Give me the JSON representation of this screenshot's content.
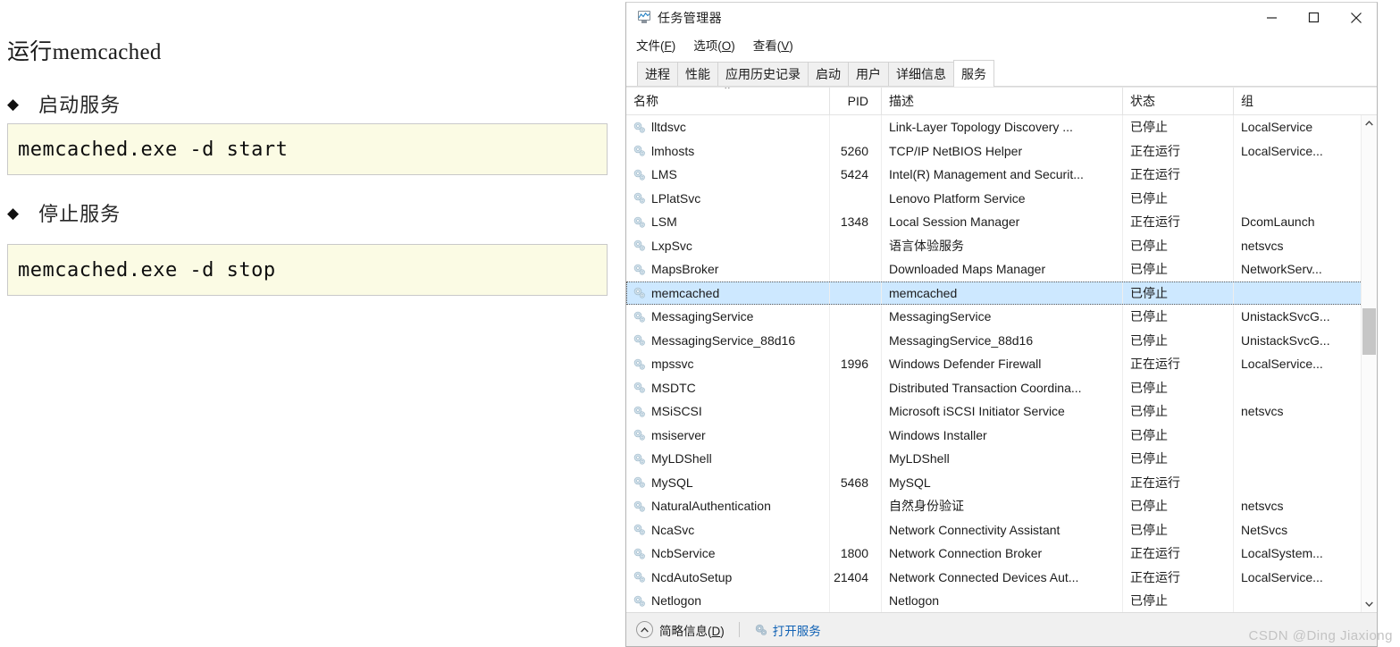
{
  "doc": {
    "title": "运行memcached",
    "sections": [
      {
        "bullet": "◆",
        "heading": "启动服务",
        "code": "memcached.exe -d start"
      },
      {
        "bullet": "◆",
        "heading": "停止服务",
        "code": "memcached.exe -d stop"
      }
    ]
  },
  "taskmanager": {
    "title": "任务管理器",
    "window_buttons": {
      "minimize": "minimize-icon",
      "maximize": "maximize-icon",
      "close": "close-icon"
    },
    "menu": [
      {
        "label": "文件",
        "accel": "F"
      },
      {
        "label": "选项",
        "accel": "O"
      },
      {
        "label": "查看",
        "accel": "V"
      }
    ],
    "tabs": [
      {
        "label": "进程",
        "active": false
      },
      {
        "label": "性能",
        "active": false
      },
      {
        "label": "应用历史记录",
        "active": false
      },
      {
        "label": "启动",
        "active": false
      },
      {
        "label": "用户",
        "active": false
      },
      {
        "label": "详细信息",
        "active": false
      },
      {
        "label": "服务",
        "active": true
      }
    ],
    "table": {
      "sort_indicator": "⌃",
      "columns": [
        "名称",
        "PID",
        "描述",
        "状态",
        "组"
      ],
      "rows": [
        {
          "name": "lltdsvc",
          "pid": "",
          "desc": "Link-Layer Topology Discovery ...",
          "status": "已停止",
          "group": "LocalService",
          "selected": false
        },
        {
          "name": "lmhosts",
          "pid": "5260",
          "desc": "TCP/IP NetBIOS Helper",
          "status": "正在运行",
          "group": "LocalService...",
          "selected": false
        },
        {
          "name": "LMS",
          "pid": "5424",
          "desc": "Intel(R) Management and Securit...",
          "status": "正在运行",
          "group": "",
          "selected": false
        },
        {
          "name": "LPlatSvc",
          "pid": "",
          "desc": "Lenovo Platform Service",
          "status": "已停止",
          "group": "",
          "selected": false
        },
        {
          "name": "LSM",
          "pid": "1348",
          "desc": "Local Session Manager",
          "status": "正在运行",
          "group": "DcomLaunch",
          "selected": false
        },
        {
          "name": "LxpSvc",
          "pid": "",
          "desc": "语言体验服务",
          "status": "已停止",
          "group": "netsvcs",
          "selected": false
        },
        {
          "name": "MapsBroker",
          "pid": "",
          "desc": "Downloaded Maps Manager",
          "status": "已停止",
          "group": "NetworkServ...",
          "selected": false
        },
        {
          "name": "memcached",
          "pid": "",
          "desc": "memcached",
          "status": "已停止",
          "group": "",
          "selected": true
        },
        {
          "name": "MessagingService",
          "pid": "",
          "desc": "MessagingService",
          "status": "已停止",
          "group": "UnistackSvcG...",
          "selected": false
        },
        {
          "name": "MessagingService_88d16",
          "pid": "",
          "desc": "MessagingService_88d16",
          "status": "已停止",
          "group": "UnistackSvcG...",
          "selected": false
        },
        {
          "name": "mpssvc",
          "pid": "1996",
          "desc": "Windows Defender Firewall",
          "status": "正在运行",
          "group": "LocalService...",
          "selected": false
        },
        {
          "name": "MSDTC",
          "pid": "",
          "desc": "Distributed Transaction Coordina...",
          "status": "已停止",
          "group": "",
          "selected": false
        },
        {
          "name": "MSiSCSI",
          "pid": "",
          "desc": "Microsoft iSCSI Initiator Service",
          "status": "已停止",
          "group": "netsvcs",
          "selected": false
        },
        {
          "name": "msiserver",
          "pid": "",
          "desc": "Windows Installer",
          "status": "已停止",
          "group": "",
          "selected": false
        },
        {
          "name": "MyLDShell",
          "pid": "",
          "desc": "MyLDShell",
          "status": "已停止",
          "group": "",
          "selected": false
        },
        {
          "name": "MySQL",
          "pid": "5468",
          "desc": "MySQL",
          "status": "正在运行",
          "group": "",
          "selected": false
        },
        {
          "name": "NaturalAuthentication",
          "pid": "",
          "desc": "自然身份验证",
          "status": "已停止",
          "group": "netsvcs",
          "selected": false
        },
        {
          "name": "NcaSvc",
          "pid": "",
          "desc": "Network Connectivity Assistant",
          "status": "已停止",
          "group": "NetSvcs",
          "selected": false
        },
        {
          "name": "NcbService",
          "pid": "1800",
          "desc": "Network Connection Broker",
          "status": "正在运行",
          "group": "LocalSystem...",
          "selected": false
        },
        {
          "name": "NcdAutoSetup",
          "pid": "21404",
          "desc": "Network Connected Devices Aut...",
          "status": "正在运行",
          "group": "LocalService...",
          "selected": false
        },
        {
          "name": "Netlogon",
          "pid": "",
          "desc": "Netlogon",
          "status": "已停止",
          "group": "",
          "selected": false
        }
      ]
    },
    "footer": {
      "less_details_label": "简略信息",
      "less_details_accel": "D",
      "open_services_label": "打开服务"
    }
  },
  "watermark": "CSDN @Ding Jiaxiong",
  "colors": {
    "selection": "#cde8ff",
    "code_bg": "#fbfbe4",
    "code_border": "#c9c9c9",
    "link": "#1363b5",
    "scrollbar_thumb": "#c6c6c6"
  }
}
